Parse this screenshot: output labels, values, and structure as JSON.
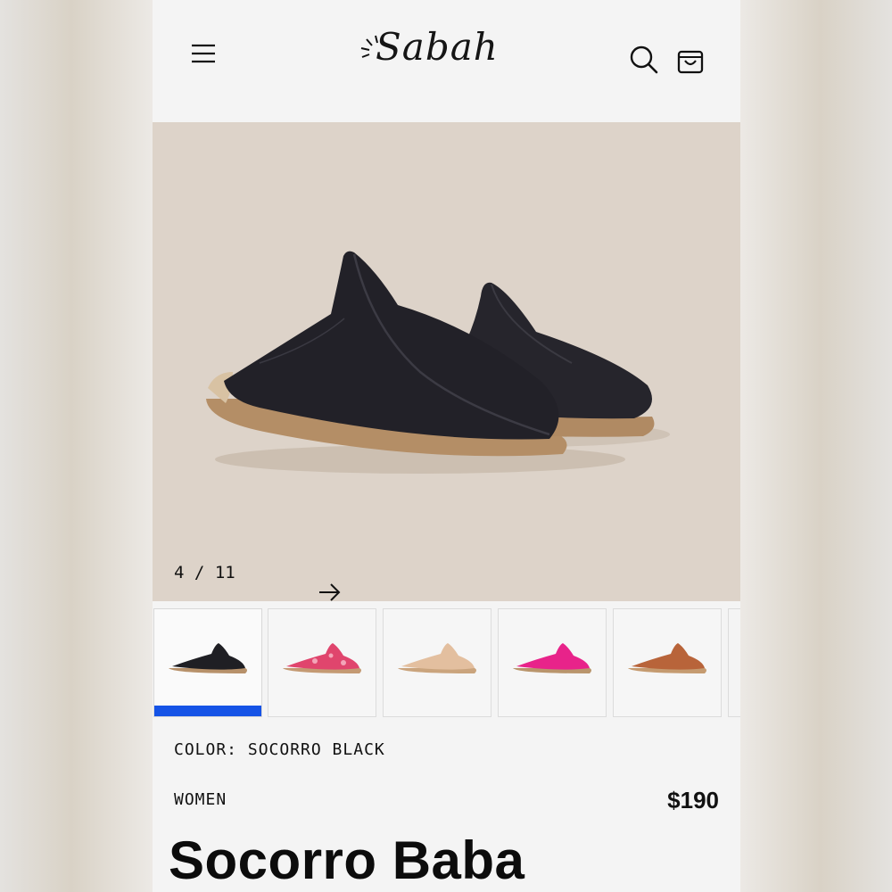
{
  "header": {
    "brand": "Sabah",
    "icons": [
      "menu-icon",
      "search-icon",
      "shopping-bag-icon"
    ]
  },
  "gallery": {
    "current": "4",
    "separator": "/",
    "total": "11",
    "next_icon": "arrow-right-icon",
    "background": "#ddd3c9"
  },
  "thumbnails": [
    {
      "color_name": "black",
      "fill": "#1f1f24",
      "sole": "#b7916a",
      "selected": true
    },
    {
      "color_name": "pink pattern",
      "fill": "#e0456d",
      "sole": "#c49a73",
      "selected": false
    },
    {
      "color_name": "nude",
      "fill": "#e3bf9f",
      "sole": "#caa47d",
      "selected": false
    },
    {
      "color_name": "fuchsia",
      "fill": "#e8238a",
      "sole": "#b9956c",
      "selected": false
    },
    {
      "color_name": "brown",
      "fill": "#b8643a",
      "sole": "#c59b70",
      "selected": false
    }
  ],
  "selected_indicator_color": "#1553e6",
  "product": {
    "color_label": "COLOR: SOCORRO BLACK",
    "category": "WOMEN",
    "price": "$190",
    "title": "Socorro Baba"
  }
}
